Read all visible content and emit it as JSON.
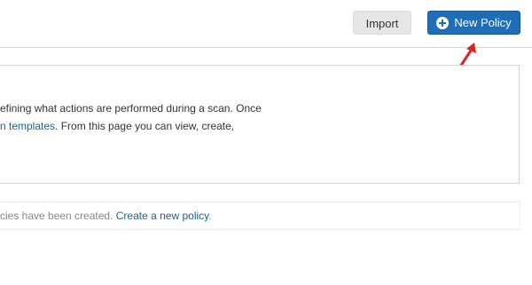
{
  "toolbar": {
    "import_label": "Import",
    "new_policy_label": "New Policy",
    "new_policy_color": "#1e6db5"
  },
  "info": {
    "line1_text": "efining what actions are performed during a scan. Once",
    "line2_link": "n templates",
    "line2_text": ". From this page you can view, create,"
  },
  "empty_state": {
    "text": "cies have been created. ",
    "link": "Create a new policy",
    "suffix": "."
  },
  "annotation": {
    "arrow_color": "#e02020"
  }
}
